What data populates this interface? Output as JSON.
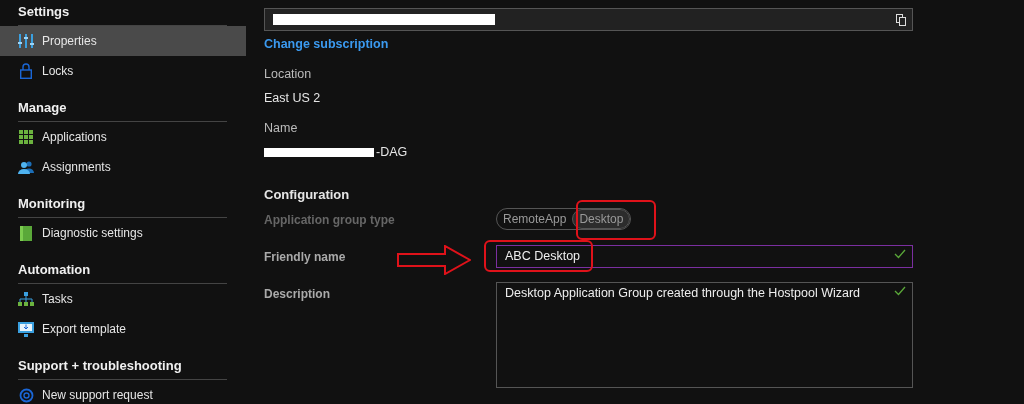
{
  "sidebar": {
    "sections": [
      {
        "title": "Settings",
        "items": [
          {
            "label": "Properties",
            "selected": true
          },
          {
            "label": "Locks",
            "selected": false
          }
        ]
      },
      {
        "title": "Manage",
        "items": [
          {
            "label": "Applications",
            "selected": false
          },
          {
            "label": "Assignments",
            "selected": false
          }
        ]
      },
      {
        "title": "Monitoring",
        "items": [
          {
            "label": "Diagnostic settings",
            "selected": false
          }
        ]
      },
      {
        "title": "Automation",
        "items": [
          {
            "label": "Tasks",
            "selected": false
          },
          {
            "label": "Export template",
            "selected": false
          }
        ]
      },
      {
        "title": "Support + troubleshooting",
        "items": [
          {
            "label": "New support request",
            "selected": false
          }
        ]
      }
    ]
  },
  "main": {
    "subscription": {
      "link": "Change subscription"
    },
    "location": {
      "label": "Location",
      "value": "East US 2"
    },
    "name": {
      "label": "Name",
      "value": "-DAG"
    },
    "configuration": {
      "title": "Configuration",
      "fields": [
        {
          "kind": "toggle",
          "label": "Application group type",
          "disabled": true,
          "options": [
            {
              "label": "RemoteApp",
              "selected": false
            },
            {
              "label": "Desktop",
              "selected": true
            }
          ]
        },
        {
          "kind": "input",
          "label": "Friendly name",
          "value": "ABC Desktop",
          "valid": true,
          "focused": true
        },
        {
          "kind": "textarea",
          "label": "Description",
          "value": "Desktop Application Group created through the Hostpool Wizard",
          "valid": true,
          "focused": false
        }
      ]
    }
  }
}
